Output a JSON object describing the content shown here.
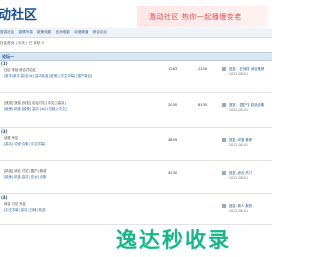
{
  "header": {
    "logo": "动社区",
    "logo_sub": "",
    "banner_text": "激动社区 热你一起播慢变老"
  },
  "nav": {
    "items": [
      "旅游社区",
      "激情写真",
      "欧美电影",
      "亚洲电影",
      "动漫频道",
      "综合论坛"
    ]
  },
  "crumb": "社区首页 | 今天 | 已 本帖 0",
  "forum": {
    "title": "论坛一"
  },
  "rows": [
    {
      "name": "(1)",
      "desc": "社区 本帖 综合讨论区",
      "sub1": "[新手]新手 高清[4k] 高清精选 [欧美] [中文字幕] [国产原创]",
      "sub2": "",
      "stat1": "1283",
      "stat2": "2200",
      "last_title": "回复: 【日韩】综合推荐",
      "last_by": "2022-08-01"
    },
    {
      "name": "",
      "desc": "[旅游] 旅游 [情侣] 论坛讨论 [中文] [高清]",
      "sub1": "[欧美] 精选 [欧美] 高清 [4k] [日韩] [中文]",
      "sub2": "",
      "stat1": "2030",
      "stat2": "8135",
      "last_title": "回复: 【国产】精选合集",
      "last_by": "2022-08-01"
    },
    {
      "name": "(3)",
      "desc": "动漫 专区",
      "sub1": "[高清] 动漫 合集 [中文字幕]",
      "sub2": "",
      "stat1": "3809",
      "stat2": "",
      "last_title": "回复: 动漫 推荐",
      "last_by": "2022-08-01"
    },
    {
      "name": "",
      "desc": "[精选] 综合 讨论 [国产] 原创",
      "sub1": "[欧美] 精选 高清 [亚洲] 合集",
      "sub2": "",
      "stat1": "4530",
      "stat2": "",
      "last_title": "回复: 综合 热门",
      "last_by": "2022-08-01"
    },
    {
      "name": "(4)",
      "desc": "综合 讨论 专区",
      "sub1": "[中文字幕] 高清 [日韩] 精选",
      "sub2": "",
      "stat1": "",
      "stat2": "",
      "last_title": "回复: 新人 报到",
      "last_by": "2022-08-01"
    }
  ],
  "watermark": "逸达秒收录"
}
